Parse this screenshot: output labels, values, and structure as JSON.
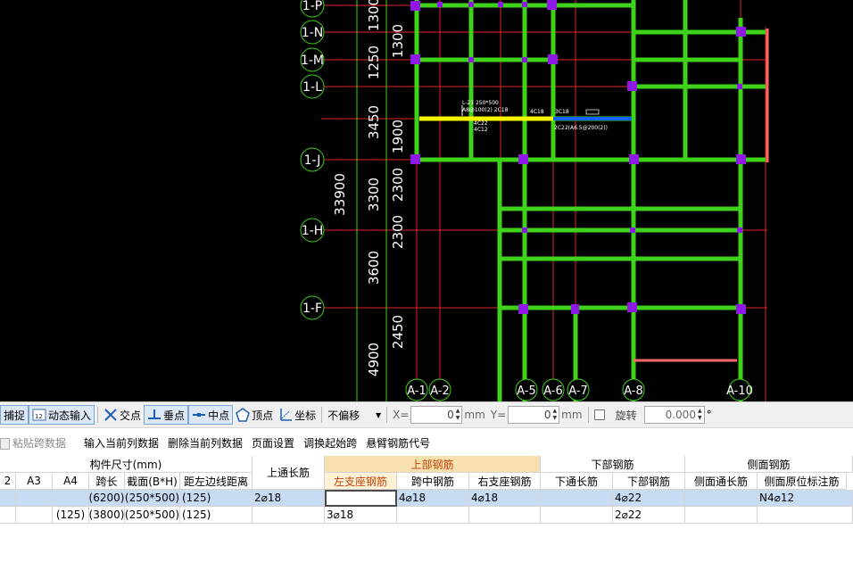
{
  "drawing": {
    "axis_labels_row": [
      "1-P",
      "1-N",
      "1-M",
      "1-L",
      "1-J",
      "1-H",
      "1-F"
    ],
    "axis_labels_col": [
      "A-1",
      "A-2",
      "A-5",
      "A-6",
      "A-7",
      "A-8",
      "A-10"
    ],
    "total_dim": "33900",
    "outer_dims": [
      "1300",
      "1250",
      "3450",
      "3300",
      "3600",
      "4900"
    ],
    "inner_dims": [
      "1300",
      "1900",
      "2300",
      "2300",
      "2450"
    ],
    "beam_annot_1": "L-21 250*500",
    "beam_annot_2": "A8@100(2) 2C18",
    "beam_annot_3": "4C18",
    "beam_annot_4": "3C18",
    "beam_annot_5": "4C22",
    "beam_annot_6": "4C12",
    "beam_annot_7": "2C22(A6.5@200(2))",
    "colors": {
      "green": "#3ed21a",
      "red": "#e2262a",
      "purple": "#8f18e6",
      "yellow": "#f5f500",
      "blue": "#1463ff",
      "pink": "#ff6b6b"
    }
  },
  "snapbar": {
    "capture": "捕捉",
    "dynamic_input": "动态输入",
    "intersection": "交点",
    "perpendicular": "垂点",
    "midpoint": "中点",
    "vertex": "顶点",
    "coordinate": "坐标",
    "offset_select": "不偏移",
    "x_label": "X=",
    "x_value": "0",
    "unit1": "mm",
    "y_label": "Y=",
    "y_value": "0",
    "unit2": "mm",
    "rotate_label": "旋转",
    "rotate_value": "0.000",
    "degree": "°"
  },
  "toolbar2": {
    "paste_span": "粘贴跨数据",
    "input_current": "输入当前列数据",
    "delete_current": "删除当前列数据",
    "page_setup": "页面设置",
    "swap_start": "调换起始跨",
    "cantilever_code": "悬臂钢筋代号"
  },
  "table": {
    "group_size": "构件尺寸(mm)",
    "top_long": "上通长筋",
    "group_upper": "上部钢筋",
    "group_lower": "下部钢筋",
    "group_side": "侧面钢筋",
    "cols": [
      "2",
      "A3",
      "A4",
      "跨长",
      "截面(B*H)",
      "距左边线距离",
      "左支座钢筋",
      "跨中钢筋",
      "右支座钢筋",
      "下通长筋",
      "下部钢筋",
      "侧面通长筋",
      "侧面原位标注筋"
    ],
    "rows": [
      {
        "a4": "",
        "span": "(6200)",
        "section": "(250*500)",
        "dist": "(125)",
        "top_long": "2⌀18",
        "left": "",
        "mid": "4⌀18",
        "right": "4⌀18",
        "bot_long": "",
        "bot": "4⌀22",
        "side_long": "",
        "side": "N4⌀12"
      },
      {
        "a4": "(125)",
        "span": "(3800)",
        "section": "(250*500)",
        "dist": "(125)",
        "top_long": "",
        "left": "3⌀18",
        "mid": "",
        "right": "",
        "bot_long": "",
        "bot": "2⌀22",
        "side_long": "",
        "side": ""
      }
    ]
  }
}
